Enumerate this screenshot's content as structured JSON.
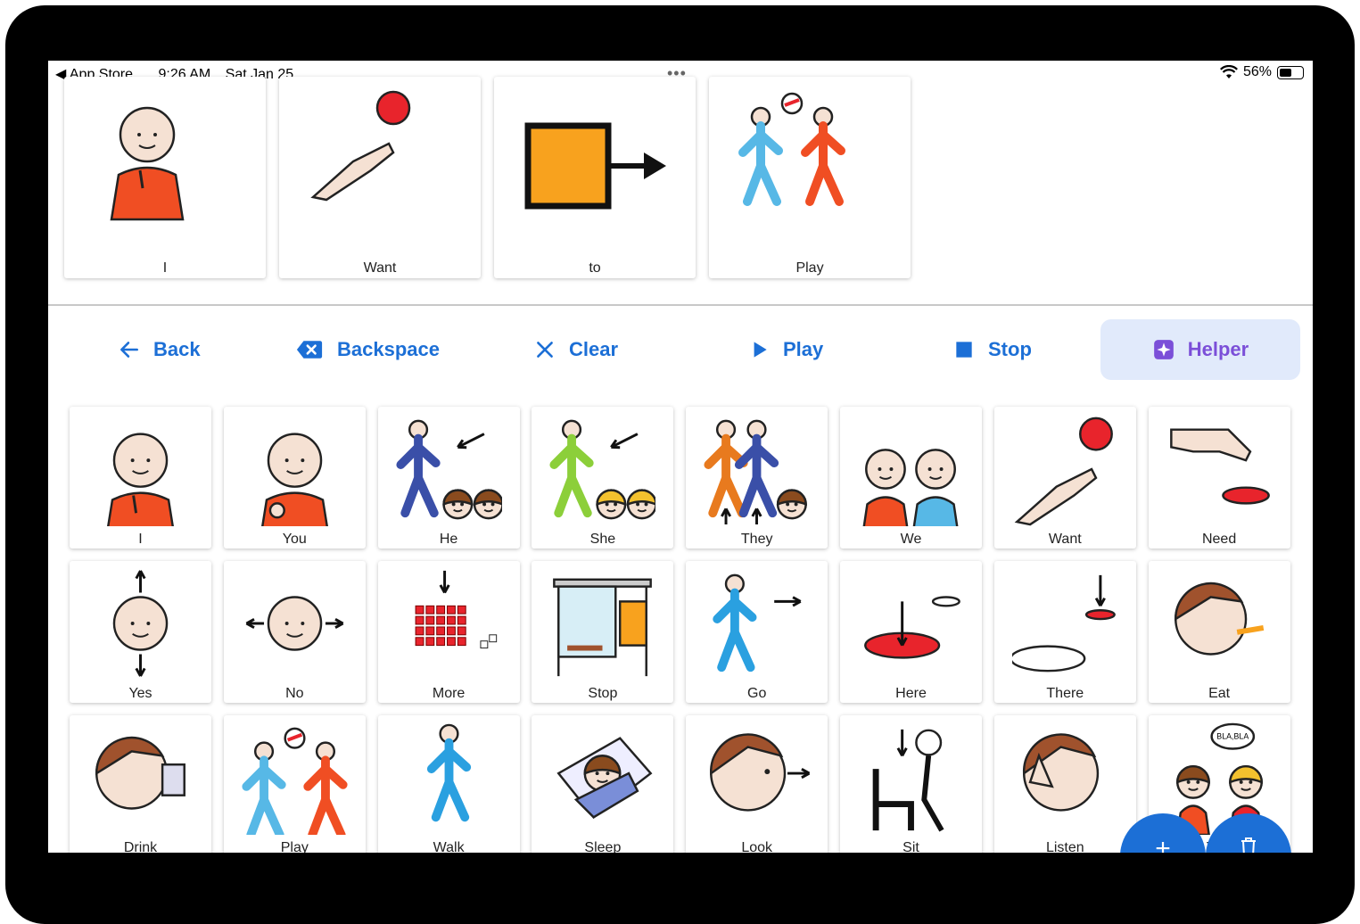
{
  "status": {
    "back_app": "App Store",
    "time": "9:26 AM",
    "date": "Sat Jan 25",
    "battery": "56%",
    "battery_level": 0.56
  },
  "sentence": [
    {
      "label": "I",
      "icon": "person-pointing-self-icon"
    },
    {
      "label": "Want",
      "icon": "hand-reaching-ball-icon"
    },
    {
      "label": "to",
      "icon": "square-arrow-icon"
    },
    {
      "label": "Play",
      "icon": "children-playing-ball-icon"
    }
  ],
  "toolbar": {
    "back": "Back",
    "backspace": "Backspace",
    "clear": "Clear",
    "play": "Play",
    "stop": "Stop",
    "helper": "Helper"
  },
  "grid": [
    {
      "label": "I",
      "icon": "person-pointing-self-icon"
    },
    {
      "label": "You",
      "icon": "person-pointing-you-icon"
    },
    {
      "label": "He",
      "icon": "boy-arrow-icon"
    },
    {
      "label": "She",
      "icon": "girl-arrow-icon"
    },
    {
      "label": "They",
      "icon": "group-people-icon"
    },
    {
      "label": "We",
      "icon": "two-people-icon"
    },
    {
      "label": "Want",
      "icon": "hand-reaching-ball-icon"
    },
    {
      "label": "Need",
      "icon": "hand-pinch-icon"
    },
    {
      "label": "Yes",
      "icon": "head-nod-icon"
    },
    {
      "label": "No",
      "icon": "head-shake-icon"
    },
    {
      "label": "More",
      "icon": "many-squares-icon"
    },
    {
      "label": "Stop",
      "icon": "bus-stop-icon"
    },
    {
      "label": "Go",
      "icon": "person-walking-arrow-icon"
    },
    {
      "label": "Here",
      "icon": "spot-here-icon"
    },
    {
      "label": "There",
      "icon": "spot-there-icon"
    },
    {
      "label": "Eat",
      "icon": "person-eating-icon"
    },
    {
      "label": "Drink",
      "icon": "person-drinking-icon"
    },
    {
      "label": "Play",
      "icon": "children-playing-ball-icon"
    },
    {
      "label": "Walk",
      "icon": "person-walking-icon"
    },
    {
      "label": "Sleep",
      "icon": "person-sleeping-icon"
    },
    {
      "label": "Look",
      "icon": "head-looking-icon"
    },
    {
      "label": "Sit",
      "icon": "person-sitting-icon"
    },
    {
      "label": "Listen",
      "icon": "head-listening-icon"
    },
    {
      "label": "Talk",
      "icon": "people-talking-icon"
    }
  ],
  "colors": {
    "accent": "#1c6fd6",
    "helper_bg": "#e1eafb",
    "helper_text": "#7b4fd8",
    "orange": "#f04e23",
    "blue": "#57b8e6"
  }
}
